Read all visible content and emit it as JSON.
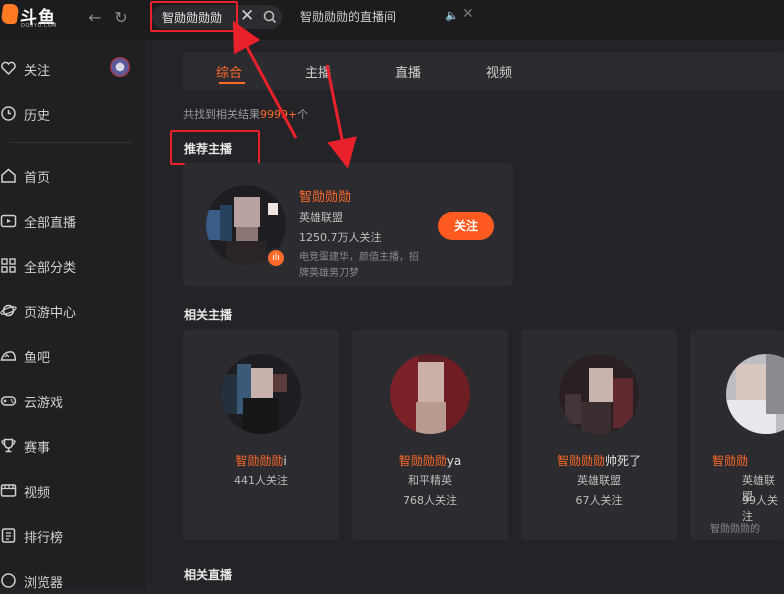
{
  "app": {
    "brand": "斗鱼",
    "brand_sub": "DOUYU.COM",
    "search_query": "智勋勋勋勋",
    "tab_title": "智勋勋勋的直播间",
    "accent": "#ff6a28"
  },
  "sidebar": {
    "items": [
      {
        "label": "关注",
        "icon": "heart-icon"
      },
      {
        "label": "历史",
        "icon": "clock-icon"
      },
      {
        "label": "首页",
        "icon": "home-icon"
      },
      {
        "label": "全部直播",
        "icon": "tv-icon"
      },
      {
        "label": "全部分类",
        "icon": "grid-icon"
      },
      {
        "label": "页游中心",
        "icon": "planet-icon"
      },
      {
        "label": "鱼吧",
        "icon": "fish-icon"
      },
      {
        "label": "云游戏",
        "icon": "gamepad-icon"
      },
      {
        "label": "赛事",
        "icon": "trophy-icon"
      },
      {
        "label": "视频",
        "icon": "video-icon"
      },
      {
        "label": "排行榜",
        "icon": "ranking-icon"
      },
      {
        "label": "浏览器",
        "icon": "browser-icon"
      }
    ]
  },
  "search_tabs": [
    "综合",
    "主播",
    "直播",
    "视频"
  ],
  "results": {
    "prefix": "共找到相关结果",
    "count": "9999+",
    "suffix": "个"
  },
  "recommended": {
    "title": "推荐主播",
    "name": "智勋勋勋",
    "category": "英雄联盟",
    "followers": "1250.7万人关注",
    "description": "电竞蛋建华，颜值主播，招牌英雄男刀梦",
    "follow_label": "关注"
  },
  "related_title": "相关主播",
  "related_streamers": [
    {
      "name_hl": "智勋勋勋",
      "name_rest": "i",
      "category": "",
      "followers": "441人关注",
      "desc": ""
    },
    {
      "name_hl": "智勋勋勋",
      "name_rest": "ya",
      "category": "和平精英",
      "followers": "768人关注",
      "desc": ""
    },
    {
      "name_hl": "智勋勋勋",
      "name_rest": "帅死了",
      "category": "英雄联盟",
      "followers": "67人关注",
      "desc": ""
    },
    {
      "name_hl": "智勋勋",
      "name_rest": "",
      "category": "英雄联盟",
      "followers": "99人关注",
      "desc": "智勋勋勋的"
    }
  ],
  "related_live_title": "相关直播"
}
